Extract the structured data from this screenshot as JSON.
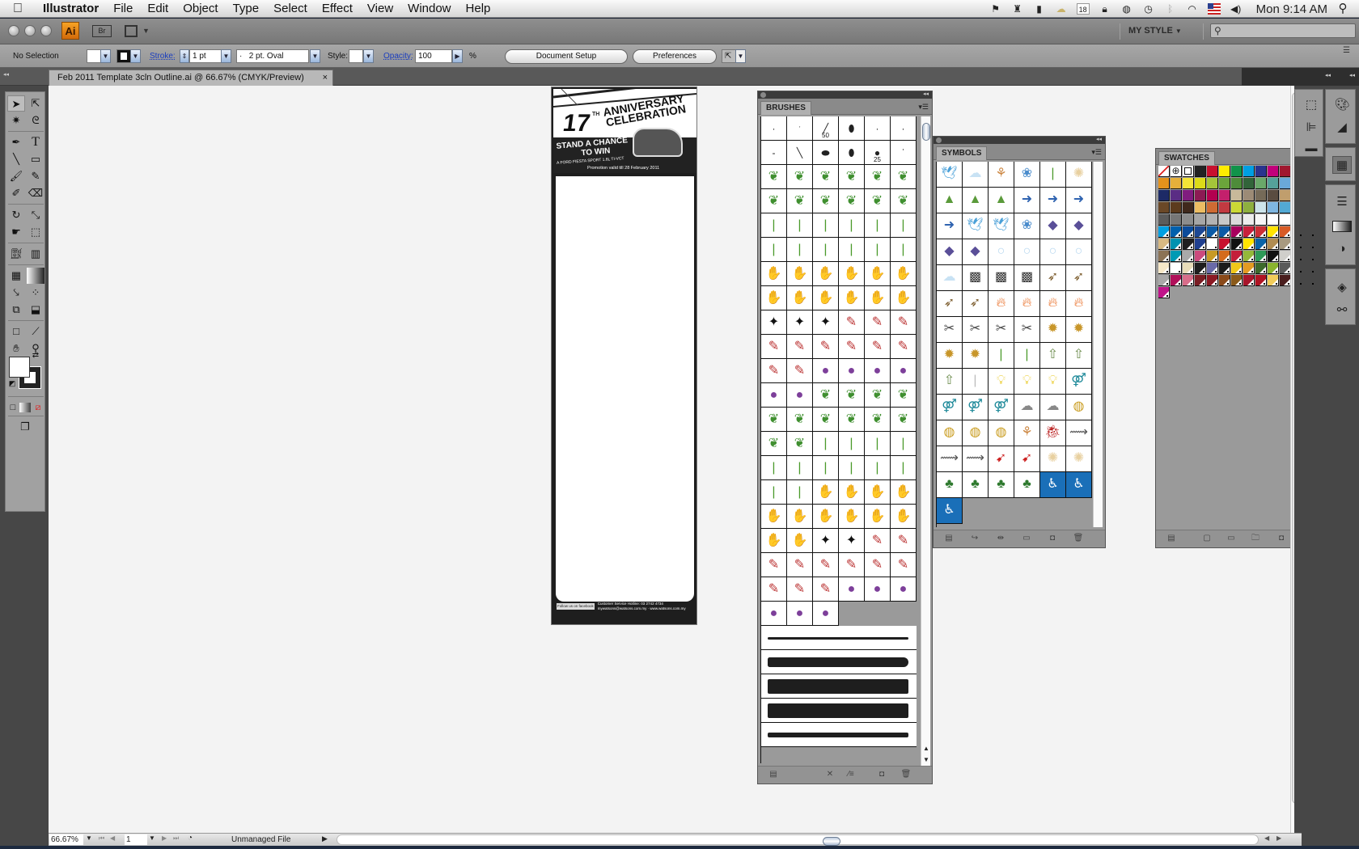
{
  "menubar": {
    "apple": "",
    "app_name": "Illustrator",
    "items": [
      "File",
      "Edit",
      "Object",
      "Type",
      "Select",
      "Effect",
      "View",
      "Window",
      "Help"
    ],
    "status_icons": [
      "bookmark-icon",
      "tophat-icon",
      "evernote-icon",
      "weather-icon",
      "calendar-icon",
      "lock-icon",
      "globe-icon",
      "timemachine-icon",
      "bluetooth-icon",
      "wifi-icon",
      "us-flag-icon",
      "volume-icon"
    ],
    "calendar_day": "18",
    "clock": "Mon 9:14 AM"
  },
  "appbar": {
    "logo": "Ai",
    "bridge": "Br",
    "workspace": "MY STYLE",
    "search_placeholder": ""
  },
  "control": {
    "selection": "No Selection",
    "stroke_label": "Stroke:",
    "stroke_weight": "1 pt",
    "brush": "2 pt. Oval",
    "brush_dot": "·",
    "style_label": "Style:",
    "opacity_label": "Opacity:",
    "opacity": "100",
    "percent": "%",
    "document_setup": "Document Setup",
    "preferences": "Preferences"
  },
  "document": {
    "tab_title": "Feb 2011 Template 3cln Outline.ai @ 66.67% (CMYK/Preview)",
    "close": "×",
    "artwork": {
      "number": "17",
      "superscript": "TH",
      "title_line1": "ANNIVERSARY",
      "title_line2": "CELEBRATION",
      "stand_line1": "STAND A CHANCE",
      "stand_line2": "TO WIN",
      "prize": "A FORD FIESTA SPORT 1.6L TI-VCT",
      "promo": "Promotion valid till 28 February 2011",
      "footer_hotline": "Customer Service Hotline: 03 2742 4734",
      "footer_email": "mywatsons@watsons.com.my",
      "footer_web": "www.watsons.com.my",
      "footer_fb": "Follow us on facebook"
    }
  },
  "status": {
    "zoom": "66.67%",
    "artboard": "1",
    "file_state": "Unmanaged File"
  },
  "brushes": {
    "title": "BRUSHES",
    "calligraphic": [
      {
        "glyph": "·",
        "size": ""
      },
      {
        "glyph": "ˑ",
        "size": ""
      },
      {
        "glyph": "╱",
        "size": "50"
      },
      {
        "glyph": "⬮",
        "size": ""
      },
      {
        "glyph": "·",
        "size": ""
      },
      {
        "glyph": "·",
        "size": ""
      },
      {
        "glyph": "-",
        "size": ""
      },
      {
        "glyph": "╲",
        "size": ""
      },
      {
        "glyph": "⬬",
        "size": ""
      },
      {
        "glyph": "⬮",
        "size": ""
      },
      {
        "glyph": "●",
        "size": "25"
      },
      {
        "glyph": "ˈ",
        "size": ""
      }
    ],
    "scatter_rows": [
      [
        "leaf",
        "leaf",
        "leaf",
        "leaf",
        "leaf",
        "leaf"
      ],
      [
        "leaf",
        "leaf",
        "leaf",
        "leaf",
        "leaf",
        "leaf"
      ],
      [
        "grass",
        "grass",
        "grass",
        "grass",
        "grass",
        "grass"
      ],
      [
        "grass",
        "grass",
        "grass",
        "grass",
        "grass",
        "grass"
      ],
      [
        "hand",
        "hand",
        "hand",
        "hand",
        "hand",
        "hand"
      ],
      [
        "hand",
        "hand",
        "hand",
        "hand",
        "hand",
        "hand"
      ],
      [
        "star",
        "star",
        "star",
        "pin",
        "pin",
        "pin"
      ],
      [
        "pin",
        "pin",
        "pin",
        "pin",
        "pin",
        "pin"
      ],
      [
        "pin",
        "pin",
        "orb",
        "orb",
        "orb",
        "orb"
      ],
      [
        "orb",
        "orb",
        "leaf",
        "leaf",
        "leaf",
        "leaf"
      ],
      [
        "leaf",
        "leaf",
        "leaf",
        "leaf",
        "leaf",
        "leaf"
      ],
      [
        "leaf",
        "leaf",
        "grass",
        "grass",
        "grass",
        "grass"
      ],
      [
        "grass",
        "grass",
        "grass",
        "grass",
        "grass",
        "grass"
      ],
      [
        "grass",
        "grass",
        "hand",
        "hand",
        "hand",
        "hand"
      ],
      [
        "hand",
        "hand",
        "hand",
        "hand",
        "hand",
        "hand"
      ],
      [
        "hand",
        "hand",
        "star",
        "star",
        "pin",
        "pin"
      ],
      [
        "pin",
        "pin",
        "pin",
        "pin",
        "pin",
        "pin"
      ],
      [
        "pin",
        "pin",
        "pin",
        "orb",
        "orb",
        "orb"
      ],
      [
        "orb",
        "orb",
        "orb"
      ]
    ],
    "art_brushes": [
      "dry-ink-thin",
      "dry-ink-taper",
      "dry-ink-thick",
      "dry-ink-thick-2",
      "dry-ink-partial"
    ],
    "footer": [
      "brush-libraries-icon",
      "remove-stroke-icon",
      "stroke-options-icon",
      "new-brush-icon",
      "delete-brush-icon"
    ]
  },
  "symbols": {
    "title": "SYMBOLS",
    "rows": [
      [
        "bird",
        "cloud",
        "flower-stem",
        "blue-flower",
        "grass",
        "dandelion"
      ],
      [
        "pyramid",
        "pyramid",
        "pyramid",
        "arrow",
        "arrow",
        "arrow"
      ],
      [
        "arrow",
        "bird",
        "bird",
        "blue-flower",
        "fish",
        "fish"
      ],
      [
        "fish",
        "fish",
        "bubble",
        "bubble",
        "bubble",
        "bubble"
      ],
      [
        "cloud",
        "net",
        "net",
        "net",
        "feather",
        "feather"
      ],
      [
        "feather",
        "feather",
        "fire",
        "fire",
        "fire",
        "fire"
      ],
      [
        "fossil",
        "fossil",
        "fossil",
        "fossil",
        "gear",
        "gear"
      ],
      [
        "gear",
        "gear",
        "grass",
        "grass",
        "up-arrow",
        "up-arrow"
      ],
      [
        "up-arrow",
        "line",
        "bulb",
        "bulb",
        "bulb",
        "restroom"
      ],
      [
        "restroom",
        "restroom",
        "restroom",
        "smudge",
        "smudge",
        "lantern"
      ],
      [
        "lantern",
        "lantern",
        "lantern",
        "flower-stem",
        "ladybug",
        "banner"
      ],
      [
        "banner",
        "banner",
        "rocket",
        "rocket",
        "dandelion",
        "dandelion"
      ],
      [
        "tree",
        "tree",
        "tree",
        "tree",
        "wheelchair",
        "wheelchair"
      ],
      [
        "wheelchair"
      ]
    ],
    "footer": [
      "symbol-libraries-icon",
      "place-instance-icon",
      "break-link-icon",
      "symbol-options-icon",
      "new-symbol-icon",
      "delete-symbol-icon"
    ]
  },
  "swatches": {
    "title": "SWATCHES",
    "special": [
      "none",
      "registration",
      "white"
    ],
    "colors": [
      "#222222",
      "#c8102e",
      "#ffec00",
      "#10934a",
      "#009fe3",
      "#29348e",
      "#c2007b",
      "#a0172f",
      "#cb3335",
      "#d45426",
      "#e3921c",
      "#e6b03a",
      "#f4e537",
      "#dcdb19",
      "#a4c43a",
      "#6ba53b",
      "#4e8c3a",
      "#32643a",
      "#6aa86a",
      "#55a19a",
      "#6aa9d9",
      "#3f6fb4",
      "#223f8a",
      "#1d2a66",
      "#5a2c84",
      "#801c7f",
      "#8c1a54",
      "#b3004f",
      "#c3206c",
      "#c8b99a",
      "#9c8b76",
      "#756a58",
      "#5a4c40",
      "#c09e6d",
      "#a67a4b",
      "#845d36",
      "#6a4827",
      "#5c3b1d",
      "#40291c",
      "#ecbd63",
      "#cf6b33",
      "#c23a41",
      "#cbd935",
      "#8eb03f",
      "#cde4ea",
      "#7fb6e0",
      "#52a9d4",
      "#262626",
      "#404040",
      "#5c5c5c",
      "#767676",
      "#8d8d8d",
      "#a6a6a6",
      "#b2b2b2",
      "#c8c8c8",
      "#dadada",
      "#ececec",
      "#f6f6f6",
      "#ffffff",
      "#ffffff",
      "#111111",
      "#3aa58c",
      "#00a0e3",
      "#0060ad",
      "#0c4b9a",
      "#1d4894",
      "#0b5aa6",
      "#0b5aa6",
      "#a8005d",
      "#c8203c",
      "#cb2f35",
      "#ffe300",
      "#d75b26",
      "#dd7f20",
      "#b08c1a",
      "#d8b982",
      "#0092b0",
      "#1f1f1f",
      "#1f3f8f",
      "#ffffff",
      "#c8102e",
      "#111111",
      "#ffe500",
      "#0a63a8",
      "#b08c52",
      "#a89a80",
      "#c4a88a",
      "#111111",
      "#8c7355",
      "#009ab4",
      "#a9a9a9",
      "#cc4a7d",
      "#c79a25",
      "#d46b1d",
      "#c41e3a",
      "#94b83a",
      "#2f9a58",
      "#111111",
      "#d0cfcb",
      "#c8157a",
      "#f5e2b0",
      "#f6e8c8",
      "#ffffff",
      "#e9dcb9",
      "#1d1d1d",
      "#6a6aa8",
      "#1b1b1b",
      "#f0c81a",
      "#e39b22",
      "#3d6a2c",
      "#8ab42e",
      "#5a5a5a",
      "#555a60",
      "#28453a",
      "#a8a8a8",
      "#b0105a",
      "#d86d8a",
      "#7a1d24",
      "#8c1a24",
      "#8a4a1a",
      "#8a5a1a",
      "#a8162c",
      "#b01424",
      "#f2cc5a",
      "#4a1e1e",
      "#dce6f0",
      "#a6b53a",
      "#c0148a"
    ],
    "tint_start": 62,
    "footer": [
      "swatch-libraries-icon",
      "swatch-kinds-icon",
      "swatch-options-icon",
      "new-color-group-icon",
      "new-swatch-icon",
      "delete-swatch-icon"
    ]
  },
  "dock": {
    "group1": [
      "transform-icon",
      "align-icon",
      "pathfinder-icon"
    ],
    "group2": [
      "color-guide-icon",
      "color-icon"
    ],
    "group3": [
      "swatches-icon"
    ],
    "group4": [
      "stroke-icon",
      "gradient-icon",
      "transparency-icon"
    ],
    "group5": [
      "layers-icon",
      "links-icon"
    ]
  }
}
